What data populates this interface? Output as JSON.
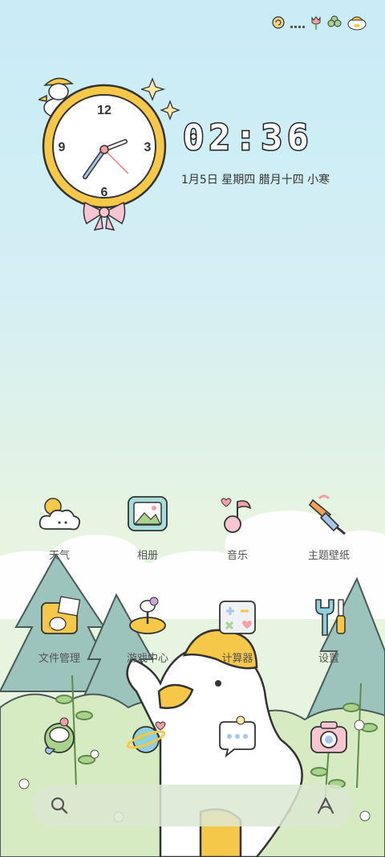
{
  "status_bar": {
    "icons": [
      "swirl-icon",
      "signal-dots-icon",
      "tulip-icon",
      "clover-icon",
      "duck-face-icon"
    ]
  },
  "clock_widget": {
    "numerals": {
      "twelve": "12",
      "three": "3",
      "six": "6",
      "nine": "9"
    },
    "time": "02:36",
    "date": "1月5日 星期四 腊月十四 小寒"
  },
  "apps": [
    {
      "label": "天气",
      "icon": "weather-cloud-sun-icon"
    },
    {
      "label": "相册",
      "icon": "photo-album-icon"
    },
    {
      "label": "音乐",
      "icon": "music-note-icon"
    },
    {
      "label": "主题壁纸",
      "icon": "paint-brush-icon"
    },
    {
      "label": "文件管理",
      "icon": "folder-duck-icon"
    },
    {
      "label": "游戏中心",
      "icon": "game-joystick-icon"
    },
    {
      "label": "计算器",
      "icon": "calculator-icon"
    },
    {
      "label": "设置",
      "icon": "settings-tools-icon"
    }
  ],
  "dock": [
    {
      "icon": "phone-duck-icon"
    },
    {
      "icon": "browser-planet-icon"
    },
    {
      "icon": "messages-bubble-icon"
    },
    {
      "icon": "camera-icon"
    }
  ],
  "search_bar": {
    "left_icon": "search-icon",
    "right_icon": "assistant-icon"
  },
  "colors": {
    "accent_yellow": "#f6c84a",
    "sky": "#c9ecf7",
    "grass": "#cfe6b4",
    "tree": "#8fb8b1"
  }
}
